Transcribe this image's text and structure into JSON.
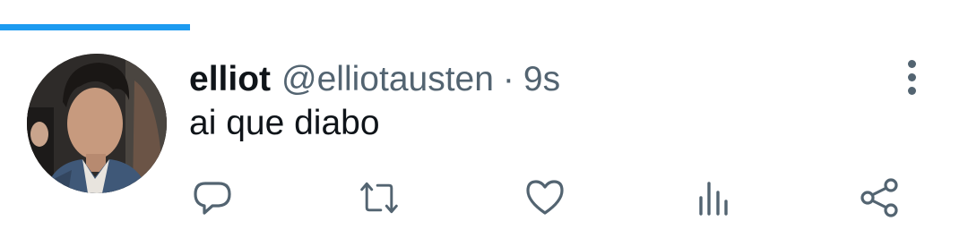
{
  "tweet": {
    "author_name": "elliot",
    "author_handle": "@elliotausten",
    "separator": "·",
    "time_ago": "9s",
    "text": "ai que diabo"
  },
  "actions": [
    {
      "icon": "reply-icon"
    },
    {
      "icon": "retweet-icon"
    },
    {
      "icon": "like-icon"
    },
    {
      "icon": "views-icon"
    },
    {
      "icon": "share-icon"
    }
  ],
  "menu": {
    "icon": "more-vertical-icon"
  },
  "colors": {
    "accent": "#1d9bf0",
    "text_primary": "#0f1419",
    "text_secondary": "#536471",
    "background": "#ffffff"
  }
}
